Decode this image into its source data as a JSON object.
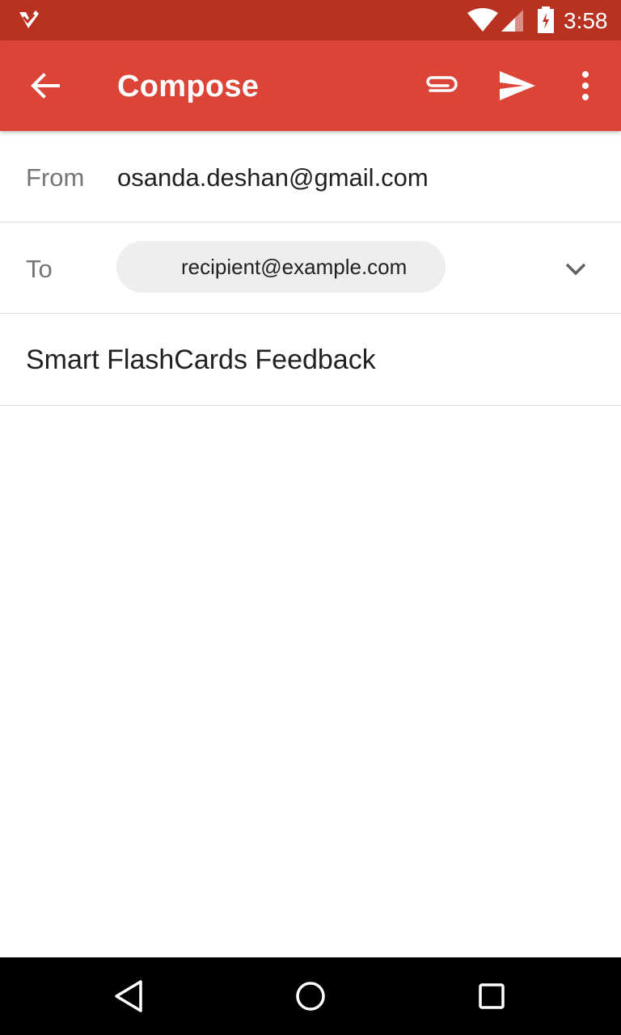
{
  "status_bar": {
    "time": "3:58",
    "icons": [
      "notification-check-icon",
      "wifi-icon",
      "signal-icon",
      "battery-charging-icon"
    ]
  },
  "toolbar": {
    "title": "Compose",
    "icons": [
      "back-arrow-icon",
      "attach-icon",
      "send-icon",
      "more-vert-icon"
    ],
    "background_color": "#db4437"
  },
  "form": {
    "from_label": "From",
    "from_value": "osanda.deshan@gmail.com",
    "to_label": "To",
    "to_recipient": "recipient@example.com",
    "subject": "Smart FlashCards Feedback",
    "body": ""
  },
  "nav_bar": {
    "icons": [
      "nav-back-icon",
      "nav-home-icon",
      "nav-recents-icon"
    ]
  },
  "colors": {
    "status_bar": "#b93221",
    "accent": "#db4437",
    "chip": "#eeeeee"
  }
}
